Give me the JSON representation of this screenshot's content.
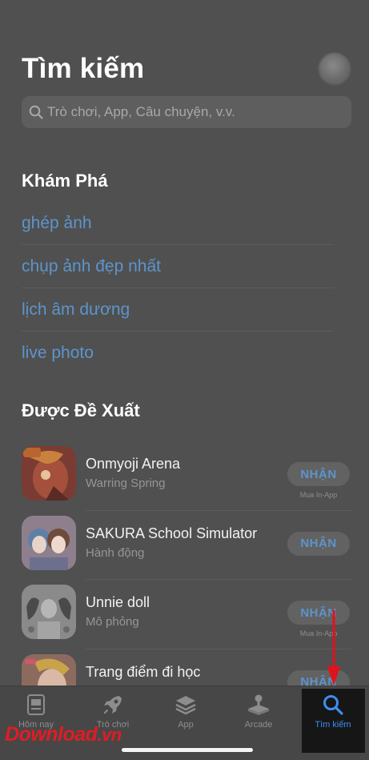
{
  "header": {
    "title": "Tìm kiếm"
  },
  "search": {
    "placeholder": "Trò chơi, App, Câu chuyện, v.v.",
    "icon": "search-icon"
  },
  "discover": {
    "heading": "Khám Phá",
    "items": [
      "ghép ảnh",
      "chụp ảnh đẹp nhất",
      "lịch âm dương",
      "live photo"
    ]
  },
  "suggested": {
    "heading": "Được Đề Xuất",
    "apps": [
      {
        "name": "Onmyoji Arena",
        "subtitle": "Warring Spring",
        "button": "NHẬN",
        "note": "Mua In-App"
      },
      {
        "name": "SAKURA School Simulator",
        "subtitle": "Hành động",
        "button": "NHẬN",
        "note": ""
      },
      {
        "name": "Unnie doll",
        "subtitle": "Mô phỏng",
        "button": "NHẬN",
        "note": "Mua In-App"
      },
      {
        "name": "Trang điểm đi học",
        "subtitle": "",
        "button": "NHẬN",
        "note": ""
      }
    ]
  },
  "tabbar": {
    "tabs": [
      {
        "label": "Hôm nay",
        "icon": "today-icon"
      },
      {
        "label": "Trò chơi",
        "icon": "rocket-icon"
      },
      {
        "label": "App",
        "icon": "layers-icon"
      },
      {
        "label": "Arcade",
        "icon": "joystick-icon"
      },
      {
        "label": "Tìm kiếm",
        "icon": "search-icon",
        "active": true
      }
    ]
  },
  "watermark": {
    "part1": "Download",
    "part2": ".vn"
  },
  "colors": {
    "link": "#5d94cc",
    "active_tab": "#3d8ef0",
    "background": "#505050",
    "annotation_arrow": "#e3111b"
  }
}
